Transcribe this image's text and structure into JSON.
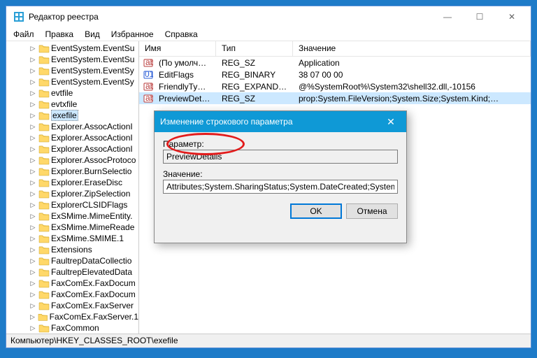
{
  "window": {
    "title": "Редактор реестра",
    "min": "—",
    "max": "☐",
    "close": "✕"
  },
  "menu": {
    "file": "Файл",
    "edit": "Правка",
    "view": "Вид",
    "favorites": "Избранное",
    "help": "Справка"
  },
  "tree": {
    "items": [
      "EventSystem.EventSu",
      "EventSystem.EventSu",
      "EventSystem.EventSy",
      "EventSystem.EventSy",
      "evtfile",
      "evtxfile",
      "exefile",
      "Explorer.AssocActionI",
      "Explorer.AssocActionI",
      "Explorer.AssocActionI",
      "Explorer.AssocProtoco",
      "Explorer.BurnSelectio",
      "Explorer.EraseDisc",
      "Explorer.ZipSelection",
      "ExplorerCLSIDFlags",
      "ExSMime.MimeEntity.",
      "ExSMime.MimeReade",
      "ExSMime.SMIME.1",
      "Extensions",
      "FaultrepDataCollectio",
      "FaultrepElevatedData",
      "FaxComEx.FaxDocum",
      "FaxComEx.FaxDocum",
      "FaxComEx.FaxServer",
      "FaxComEx.FaxServer.1",
      "FaxCommon"
    ],
    "selectedIndex": 6
  },
  "list": {
    "cols": {
      "name": "Имя",
      "type": "Тип",
      "value": "Значение"
    },
    "rows": [
      {
        "name": "(По умолчанию)",
        "type": "REG_SZ",
        "value": "Application",
        "icon": "str"
      },
      {
        "name": "EditFlags",
        "type": "REG_BINARY",
        "value": "38 07 00 00",
        "icon": "bin"
      },
      {
        "name": "FriendlyTypeNam…",
        "type": "REG_EXPAND_SZ",
        "value": "@%SystemRoot%\\System32\\shell32.dll,-10156",
        "icon": "str"
      },
      {
        "name": "PreviewDetails",
        "type": "REG_SZ",
        "value": "prop:System.FileVersion;System.Size;System.Kind;…",
        "icon": "str"
      }
    ],
    "selectedIndex": 3
  },
  "dialog": {
    "title": "Изменение строкового параметра",
    "paramLabel": "Параметр:",
    "paramValue": "PreviewDetails",
    "valueLabel": "Значение:",
    "valueValue": "Attributes;System.SharingStatus;System.DateCreated;System.DateModified",
    "ok": "OK",
    "cancel": "Отмена"
  },
  "status": {
    "path": "Компьютер\\HKEY_CLASSES_ROOT\\exefile"
  }
}
